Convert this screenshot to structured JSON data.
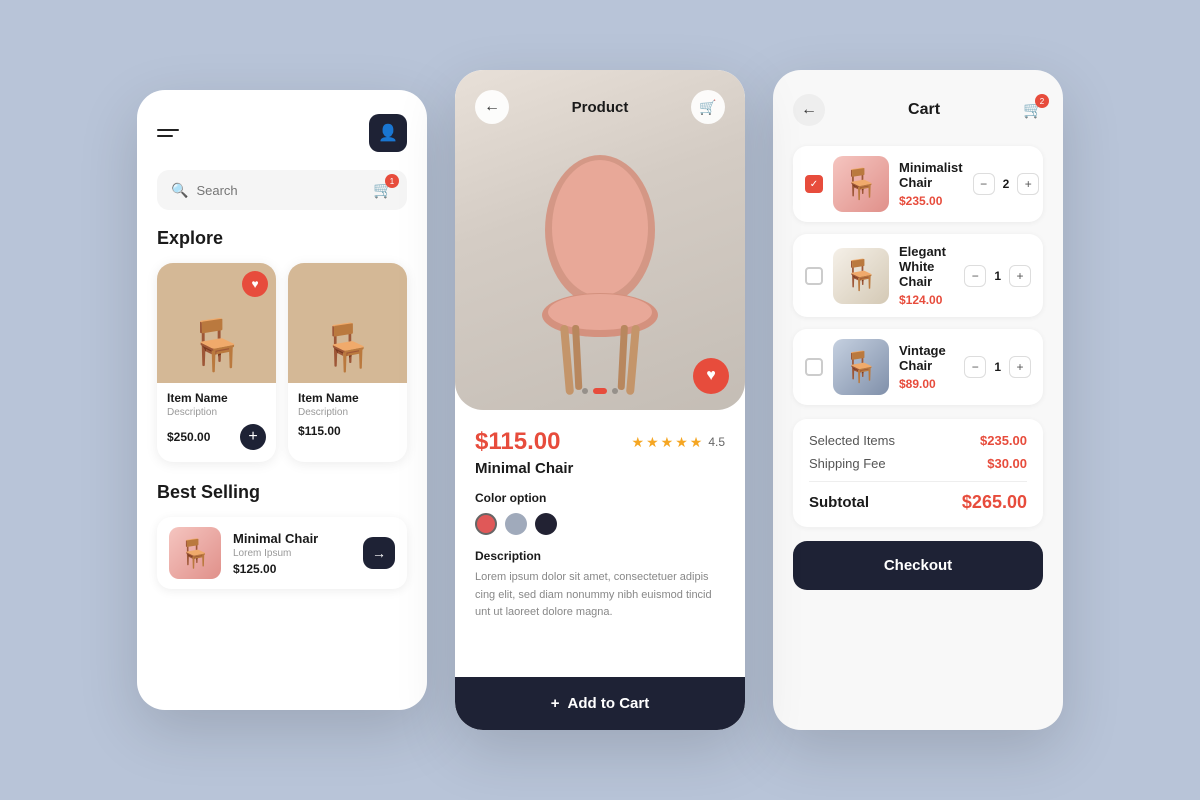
{
  "screen1": {
    "menu_label": "Menu",
    "avatar_label": "User",
    "search_placeholder": "Search",
    "explore_title": "Explore",
    "items": [
      {
        "name": "Item Name",
        "description": "Description",
        "price": "$250.00"
      },
      {
        "name": "Item Name",
        "description": "Description",
        "price": "$115.00"
      }
    ],
    "best_selling_title": "Best Selling",
    "best_selling_item": {
      "name": "Minimal Chair",
      "sub": "Lorem Ipsum",
      "price": "$125.00"
    }
  },
  "screen2": {
    "title": "Product",
    "price": "$115.00",
    "name": "Minimal Chair",
    "rating": "4.5",
    "color_label": "Color option",
    "colors": [
      "#e05858",
      "#a0aabb",
      "#222233"
    ],
    "desc_label": "Description",
    "desc_text": "Lorem ipsum dolor sit amet, consectetuer adipis cing elit, sed diam nonummy nibh euismod tincid unt ut laoreet dolore magna.",
    "add_to_cart": "Add to Cart"
  },
  "screen3": {
    "title": "Cart",
    "items": [
      {
        "name": "Minimalist Chair",
        "price": "$235.00",
        "qty": 2,
        "checked": true
      },
      {
        "name": "Elegant White Chair",
        "price": "$124.00",
        "qty": 1,
        "checked": false
      },
      {
        "name": "Vintage Chair",
        "price": "$89.00",
        "qty": 1,
        "checked": false
      }
    ],
    "selected_items_label": "Selected Items",
    "selected_items_value": "$235.00",
    "shipping_label": "Shipping Fee",
    "shipping_value": "$30.00",
    "subtotal_label": "Subtotal",
    "subtotal_value": "$265.00",
    "checkout_label": "Checkout"
  }
}
